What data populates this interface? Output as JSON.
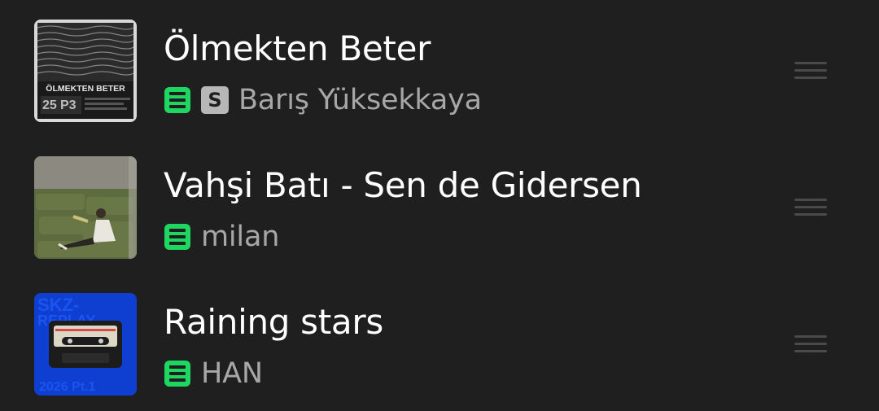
{
  "tracks": [
    {
      "title": "Ölmekten Beter",
      "artist": "Barış Yüksekkaya",
      "downloaded": true,
      "has_s_badge": true,
      "s_badge": "S",
      "cover": {
        "style": "black-white ocean waves",
        "text": "ÖLMEKTEN BETER"
      }
    },
    {
      "title": "Vahşi Batı - Sen de Gidersen",
      "artist": "milan",
      "downloaded": true,
      "has_s_badge": false,
      "cover": {
        "style": "photo person sitting on hay bales"
      }
    },
    {
      "title": "Raining stars",
      "artist": "HAN",
      "downloaded": true,
      "has_s_badge": false,
      "cover": {
        "style": "blue cassette tape",
        "text": "SKZ-REPLAY 2026 Pt.1"
      }
    }
  ],
  "colors": {
    "background": "#1f1f1f",
    "title": "#ffffff",
    "artist": "#a7a7a7",
    "download_green": "#1ed760",
    "badge_gray": "#b7b7b7",
    "drag_handle": "#4a4a4a"
  },
  "icons": {
    "download": "download-icon",
    "drag": "drag-handle-icon"
  }
}
